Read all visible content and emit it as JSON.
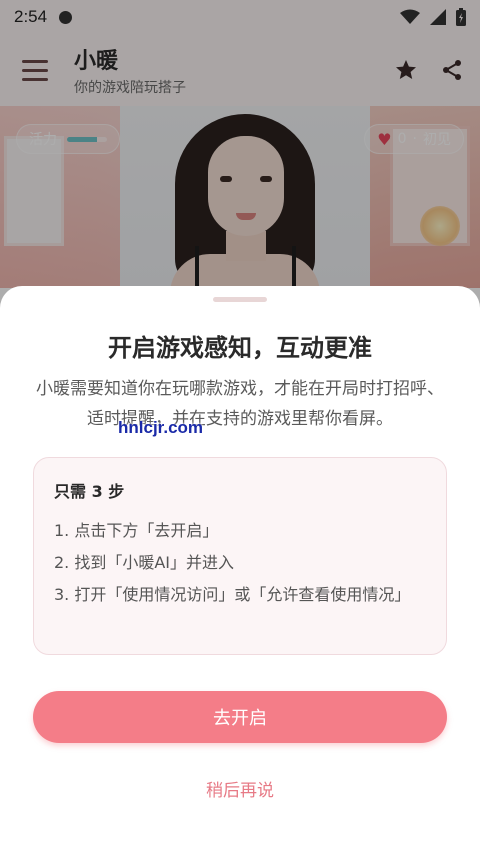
{
  "status_bar": {
    "time": "2:54"
  },
  "app_bar": {
    "title": "小暖",
    "subtitle": "你的游戏陪玩搭子"
  },
  "hero": {
    "energy_label": "活力",
    "energy_level": 0.75,
    "affinity_count": "0",
    "affinity_separator": "·",
    "affinity_level": "初见"
  },
  "sheet": {
    "title": "开启游戏感知，互动更准",
    "description": "小暖需要知道你在玩哪款游戏，才能在开局时打招呼、适时提醒，并在支持的游戏里帮你看屏。",
    "watermark": "hnlcjr.com",
    "steps_title": "只需 3 步",
    "steps": [
      "1. 点击下方「去开启」",
      "2. 找到「小暖AI」并进入",
      "3. 打开「使用情况访问」或「允许查看使用情况」"
    ],
    "primary_button": "去开启",
    "secondary_button": "稍后再说"
  },
  "colors": {
    "accent": "#f47d88",
    "accent_text": "#e77a86",
    "card_bg": "#fcf5f6",
    "heart": "#e9485d"
  },
  "icons": [
    "menu-icon",
    "star-icon",
    "share-icon",
    "wifi-icon",
    "signal-icon",
    "battery-icon",
    "heart-icon"
  ]
}
